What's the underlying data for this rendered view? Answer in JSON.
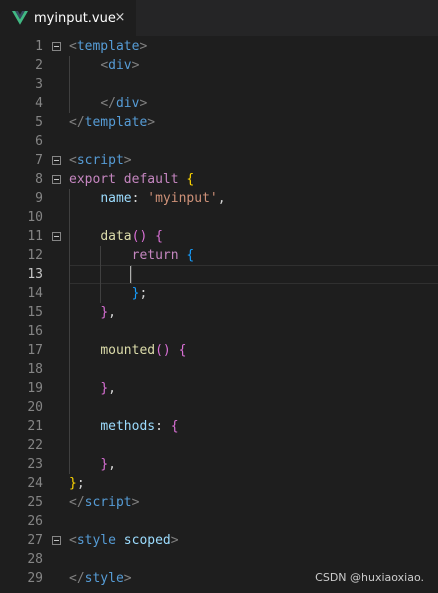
{
  "tab": {
    "label": "myinput.vue",
    "close": "×",
    "icon": "vue-icon",
    "icon_color": "#41b883"
  },
  "editor": {
    "current_line": 13,
    "lines": [
      {
        "n": "1",
        "fold": true,
        "tokens": [
          [
            "t-punc",
            "<"
          ],
          [
            "t-tag",
            "template"
          ],
          [
            "t-punc",
            ">"
          ]
        ]
      },
      {
        "n": "2",
        "fold": false,
        "tokens": [
          [
            "t-plain",
            "    "
          ],
          [
            "t-punc",
            "<"
          ],
          [
            "t-tag",
            "div"
          ],
          [
            "t-punc",
            ">"
          ]
        ]
      },
      {
        "n": "3",
        "fold": false,
        "tokens": []
      },
      {
        "n": "4",
        "fold": false,
        "tokens": [
          [
            "t-plain",
            "    "
          ],
          [
            "t-punc",
            "</"
          ],
          [
            "t-tag",
            "div"
          ],
          [
            "t-punc",
            ">"
          ]
        ]
      },
      {
        "n": "5",
        "fold": false,
        "tokens": [
          [
            "t-punc",
            "</"
          ],
          [
            "t-tag",
            "template"
          ],
          [
            "t-punc",
            ">"
          ]
        ]
      },
      {
        "n": "6",
        "fold": false,
        "tokens": []
      },
      {
        "n": "7",
        "fold": true,
        "tokens": [
          [
            "t-punc",
            "<"
          ],
          [
            "t-tag",
            "script"
          ],
          [
            "t-punc",
            ">"
          ]
        ]
      },
      {
        "n": "8",
        "fold": true,
        "tokens": [
          [
            "t-kw",
            "export"
          ],
          [
            "t-plain",
            " "
          ],
          [
            "t-kw",
            "default"
          ],
          [
            "t-plain",
            " "
          ],
          [
            "t-brace1",
            "{"
          ]
        ]
      },
      {
        "n": "9",
        "fold": false,
        "tokens": [
          [
            "t-plain",
            "    "
          ],
          [
            "t-prop",
            "name"
          ],
          [
            "t-plain",
            ": "
          ],
          [
            "t-str",
            "'myinput'"
          ],
          [
            "t-plain",
            ","
          ]
        ]
      },
      {
        "n": "10",
        "fold": false,
        "tokens": []
      },
      {
        "n": "11",
        "fold": true,
        "tokens": [
          [
            "t-plain",
            "    "
          ],
          [
            "t-fn",
            "data"
          ],
          [
            "t-brace2",
            "()"
          ],
          [
            "t-plain",
            " "
          ],
          [
            "t-brace2",
            "{"
          ]
        ]
      },
      {
        "n": "12",
        "fold": false,
        "tokens": [
          [
            "t-plain",
            "        "
          ],
          [
            "t-kw",
            "return"
          ],
          [
            "t-plain",
            " "
          ],
          [
            "t-brace3",
            "{"
          ]
        ]
      },
      {
        "n": "13",
        "fold": false,
        "tokens": []
      },
      {
        "n": "14",
        "fold": false,
        "tokens": [
          [
            "t-plain",
            "        "
          ],
          [
            "t-brace3",
            "}"
          ],
          [
            "t-plain",
            ";"
          ]
        ]
      },
      {
        "n": "15",
        "fold": false,
        "tokens": [
          [
            "t-plain",
            "    "
          ],
          [
            "t-brace2",
            "}"
          ],
          [
            "t-plain",
            ","
          ]
        ]
      },
      {
        "n": "16",
        "fold": false,
        "tokens": []
      },
      {
        "n": "17",
        "fold": false,
        "tokens": [
          [
            "t-plain",
            "    "
          ],
          [
            "t-fn",
            "mounted"
          ],
          [
            "t-brace2",
            "()"
          ],
          [
            "t-plain",
            " "
          ],
          [
            "t-brace2",
            "{"
          ]
        ]
      },
      {
        "n": "18",
        "fold": false,
        "tokens": []
      },
      {
        "n": "19",
        "fold": false,
        "tokens": [
          [
            "t-plain",
            "    "
          ],
          [
            "t-brace2",
            "}"
          ],
          [
            "t-plain",
            ","
          ]
        ]
      },
      {
        "n": "20",
        "fold": false,
        "tokens": []
      },
      {
        "n": "21",
        "fold": false,
        "tokens": [
          [
            "t-plain",
            "    "
          ],
          [
            "t-prop",
            "methods"
          ],
          [
            "t-plain",
            ": "
          ],
          [
            "t-brace2",
            "{"
          ]
        ]
      },
      {
        "n": "22",
        "fold": false,
        "tokens": []
      },
      {
        "n": "23",
        "fold": false,
        "tokens": [
          [
            "t-plain",
            "    "
          ],
          [
            "t-brace2",
            "}"
          ],
          [
            "t-plain",
            ","
          ]
        ]
      },
      {
        "n": "24",
        "fold": false,
        "tokens": [
          [
            "t-brace1",
            "}"
          ],
          [
            "t-plain",
            ";"
          ]
        ]
      },
      {
        "n": "25",
        "fold": false,
        "tokens": [
          [
            "t-punc",
            "</"
          ],
          [
            "t-tag",
            "script"
          ],
          [
            "t-punc",
            ">"
          ]
        ]
      },
      {
        "n": "26",
        "fold": false,
        "tokens": []
      },
      {
        "n": "27",
        "fold": true,
        "tokens": [
          [
            "t-punc",
            "<"
          ],
          [
            "t-tag",
            "style"
          ],
          [
            "t-plain",
            " "
          ],
          [
            "t-attr",
            "scoped"
          ],
          [
            "t-punc",
            ">"
          ]
        ]
      },
      {
        "n": "28",
        "fold": false,
        "tokens": []
      },
      {
        "n": "29",
        "fold": false,
        "tokens": [
          [
            "t-punc",
            "</"
          ],
          [
            "t-tag",
            "style"
          ],
          [
            "t-punc",
            ">"
          ]
        ]
      }
    ]
  },
  "watermark": "CSDN @huxiaoxiao."
}
